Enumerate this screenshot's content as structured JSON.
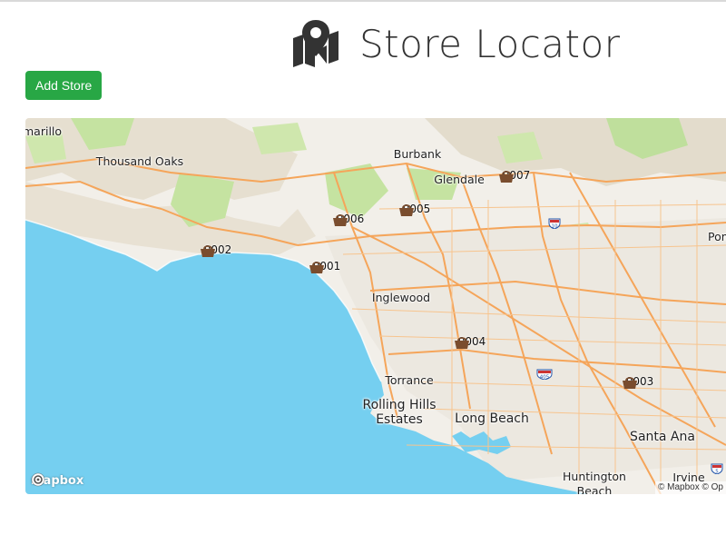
{
  "header": {
    "title": "Store Locator",
    "icon": "map-marker-icon"
  },
  "toolbar": {
    "add_store_label": "Add Store"
  },
  "colors": {
    "accent_green": "#28a745",
    "water": "#75cff0",
    "land": "#f2efe9",
    "park": "#c5e3a1",
    "road": "#f5a55a",
    "marker": "#7a4d2e"
  },
  "map": {
    "places": [
      {
        "name": "marillo"
      },
      {
        "name": "Thousand Oaks"
      },
      {
        "name": "Burbank"
      },
      {
        "name": "Glendale"
      },
      {
        "name": "Inglewood"
      },
      {
        "name": "Torrance"
      },
      {
        "name": "Rolling Hills\nEstates"
      },
      {
        "name": "Long Beach"
      },
      {
        "name": "Santa Ana"
      },
      {
        "name": "Huntington\nBeach"
      },
      {
        "name": "Irvine"
      },
      {
        "name": "Pom"
      }
    ],
    "stores": [
      {
        "id": "0001"
      },
      {
        "id": "0002"
      },
      {
        "id": "0003"
      },
      {
        "id": "0004"
      },
      {
        "id": "0005"
      },
      {
        "id": "0006"
      },
      {
        "id": "0007"
      }
    ],
    "highway_shields": [
      "10",
      "405",
      "5"
    ],
    "logo_text": "mapbox",
    "attribution": "© Mapbox © Op"
  }
}
